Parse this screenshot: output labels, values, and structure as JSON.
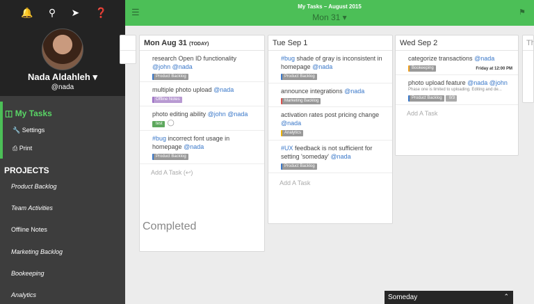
{
  "sidebar": {
    "icons": [
      "bell-icon",
      "search-icon",
      "paper-plane-icon",
      "help-icon"
    ],
    "user_name": "Nada Aldahleh ▾",
    "user_handle": "@nada",
    "menu": {
      "my_tasks": "My Tasks",
      "settings": "Settings",
      "print": "Print"
    },
    "projects_heading": "PROJECTS",
    "projects": [
      "Product Backlog",
      "Team Activities",
      "Offline Notes",
      "Marketing Backlog",
      "Bookeeping",
      "Analytics"
    ]
  },
  "header": {
    "title": "My Tasks – August 2015",
    "date": "Mon 31 ▾"
  },
  "columns": {
    "prev": {
      "title": ""
    },
    "mon": {
      "title": "Mon Aug 31",
      "today": "(TODAY)",
      "tasks": [
        {
          "text": "research Open ID functionality",
          "mentions": "@john @nada",
          "badge": "Product Backlog"
        },
        {
          "text": "multiple photo upload",
          "mentions": "@nada",
          "badge": "Offline Notes"
        },
        {
          "text": "photo editing ability",
          "mentions": "@john @nada",
          "badge": "test"
        },
        {
          "hashtag": "#bug",
          "text": "incorrect font usage in homepage",
          "mentions": "@nada",
          "badge": "Product Backlog"
        }
      ],
      "add": "Add A Task (↩)",
      "completed": "Completed"
    },
    "tue": {
      "title": "Tue Sep 1",
      "tasks": [
        {
          "hashtag": "#bug",
          "text": "shade of gray is inconsistent in homepage",
          "mentions": "@nada",
          "badge": "Product Backlog"
        },
        {
          "text": "announce integrations",
          "mentions": "@nada",
          "badge": "Marketing Backlog"
        },
        {
          "text": "activation rates post pricing change",
          "mentions": "@nada",
          "badge": "Analytics"
        },
        {
          "hashtag": "#UX",
          "text": "feedback is not sufficient for setting 'someday'",
          "mentions": "@nada",
          "badge": "Product Backlog"
        }
      ],
      "add": "Add A Task"
    },
    "wed": {
      "title": "Wed Sep 2",
      "tasks": [
        {
          "text": "categorize transactions",
          "mentions": "@nada",
          "badge": "Bookeeping",
          "time": "Friday at 12:00 PM"
        },
        {
          "text": "photo upload feature",
          "mentions": "@nada @john",
          "desc": "Phase one is limited to uploading. Editing and de...",
          "badge": "Product Backlog",
          "count": "0/3"
        }
      ],
      "add": "Add A Task"
    },
    "next": {
      "title": "Th"
    }
  },
  "someday": {
    "label": "Someday",
    "chevron": "⌃"
  },
  "colors": {
    "accent": "#4cbf57",
    "sidebar": "#3d3d3d",
    "mention": "#3a78c9"
  }
}
